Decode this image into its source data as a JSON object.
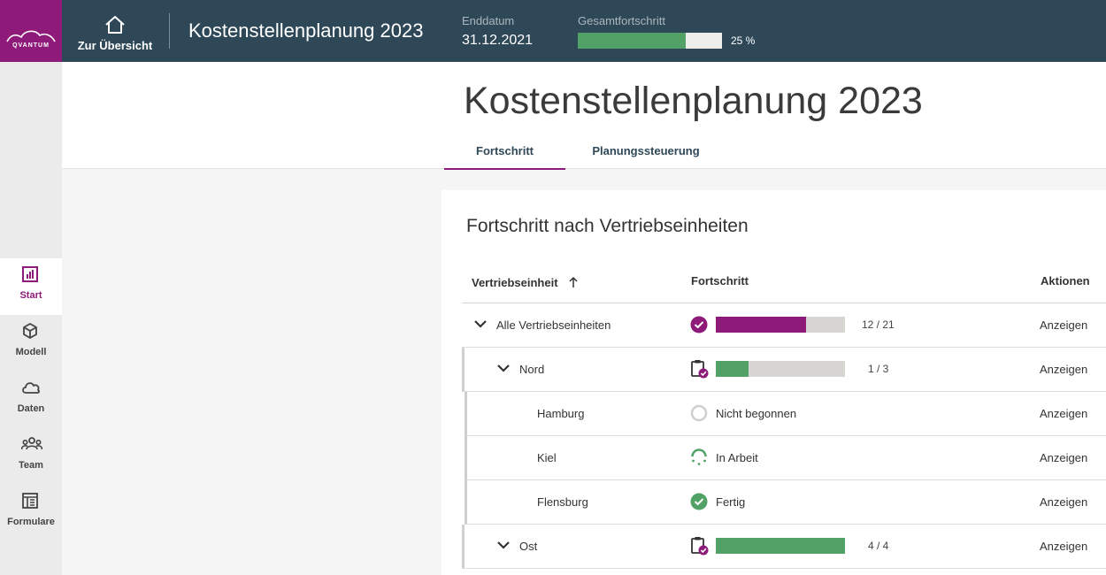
{
  "topbar": {
    "logo_text": "QVANTUM",
    "back_label": "Zur Übersicht",
    "title": "Kostenstellenplanung 2023",
    "end_date_caption": "Enddatum",
    "end_date_value": "31.12.2021",
    "progress_caption": "Gesamtfortschritt",
    "progress_fraction": 0.75,
    "progress_text": "25 %",
    "bar_color": "#52a267"
  },
  "sidebar": {
    "items": [
      {
        "label": "Start",
        "icon": "chart-icon",
        "active": true
      },
      {
        "label": "Modell",
        "icon": "cube-icon"
      },
      {
        "label": "Daten",
        "icon": "cloud-icon"
      },
      {
        "label": "Team",
        "icon": "team-icon"
      },
      {
        "label": "Formulare",
        "icon": "form-icon"
      }
    ]
  },
  "page": {
    "title": "Kostenstellenplanung 2023",
    "tabs": [
      {
        "label": "Fortschritt",
        "active": true
      },
      {
        "label": "Planungssteuerung"
      }
    ]
  },
  "card": {
    "title": "Fortschritt nach Vertriebseinheiten",
    "columns": {
      "unit": "Vertriebseinheit",
      "progress": "Fortschritt",
      "actions": "Aktionen"
    },
    "rows": [
      {
        "name": "Alle Vertriebseinheiten",
        "level": 0,
        "icon": "check-circle-icon",
        "fraction": 0.7,
        "bar_color": "#8e1a7a",
        "count": "12 / 21",
        "action": "Anzeigen"
      },
      {
        "name": "Nord",
        "level": 1,
        "icon": "clipboard-check-icon",
        "fraction": 0.25,
        "bar_color": "#52a267",
        "count": "1 / 3",
        "action": "Anzeigen"
      },
      {
        "name": "Hamburg",
        "level": 2,
        "icon": "empty-circle-icon",
        "status": "Nicht begonnen",
        "action": "Anzeigen"
      },
      {
        "name": "Kiel",
        "level": 2,
        "icon": "in-progress-icon",
        "status": "In Arbeit",
        "action": "Anzeigen"
      },
      {
        "name": "Flensburg",
        "level": 2,
        "icon": "green-check-icon",
        "status": "Fertig",
        "action": "Anzeigen"
      },
      {
        "name": "Ost",
        "level": 1,
        "icon": "clipboard-check-icon",
        "fraction": 1.0,
        "bar_color": "#52a267",
        "count": "4 / 4",
        "action": "Anzeigen"
      }
    ]
  },
  "colors": {
    "brand": "#8e1a7a",
    "header": "#2f4858",
    "success": "#52a267"
  }
}
